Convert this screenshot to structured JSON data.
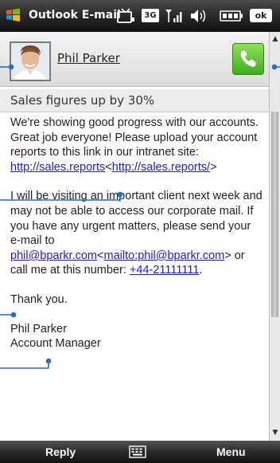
{
  "titlebar": {
    "app_title": "Outlook E-mail",
    "icons": [
      "windows-start-icon",
      "tv-icon",
      "3g-icon",
      "signal-icon",
      "speaker-icon",
      "battery-icon",
      "ok-icon"
    ],
    "ok_label": "ok",
    "threeg_label": "3G"
  },
  "sender": {
    "name": "Phil Parker",
    "avatar_icon": "contact-photo-icon",
    "call_icon": "phone-handset-icon"
  },
  "message": {
    "subject": "Sales figures up by 30%",
    "para1_text": "We're showing good progress with our accounts. Great job everyone! Please upload your account reports to this link in our intranet site: ",
    "link1": "http://sales.reports",
    "link2": "http://sales.reports/",
    "para2_text": "I will be visiting an important client next week and may not be able to access our corporate mail. If you have any urgent matters, please send your e-mail to ",
    "email": "phil@bparkr.com",
    "mailto": "mailto:phil@bparkr.com",
    "para2_tail": " or call me at this number: ",
    "phone": "+44-21111111",
    "thanks": "Thank you.",
    "signature_name": "Phil Parker",
    "signature_title": "Account Manager"
  },
  "softkeys": {
    "left": "Reply",
    "right": "Menu",
    "center_icon": "keyboard-icon"
  },
  "colors": {
    "link": "#1a1ae8",
    "call_green": "#3fae1e",
    "callout_blue": "#1e6fd0"
  }
}
